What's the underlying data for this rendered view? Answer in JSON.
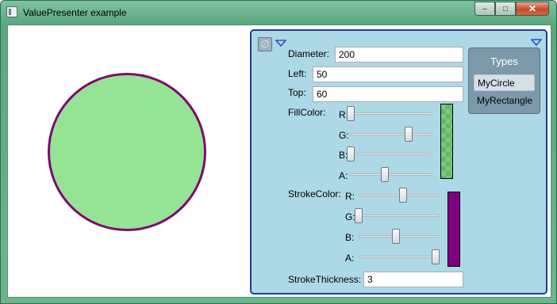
{
  "window": {
    "title": "ValuePresenter example",
    "controls": {
      "minimize": "–",
      "maximize": "□",
      "close": "✕"
    }
  },
  "panel": {
    "null_button": "∅",
    "diameter": {
      "label": "Diameter:",
      "value": "200"
    },
    "left": {
      "label": "Left:",
      "value": "50"
    },
    "top": {
      "label": "Top:",
      "value": "60"
    },
    "fill": {
      "label": "FillColor:",
      "r": "R:",
      "g": "G:",
      "b": "B:",
      "a": "A:",
      "values": {
        "r": 0.0,
        "g": 0.73,
        "b": 0.0,
        "a": 0.42
      },
      "color": "#95e394"
    },
    "stroke": {
      "label": "StrokeColor:",
      "r": "R:",
      "g": "G:",
      "b": "B:",
      "a": "A:",
      "values": {
        "r": 0.55,
        "g": 0.0,
        "b": 0.46,
        "a": 1.0
      },
      "color": "#800080"
    },
    "stroke_thickness": {
      "label": "StrokeThickness:",
      "value": "3"
    },
    "types": {
      "title": "Types",
      "items": [
        "MyCircle",
        "MyRectangle"
      ],
      "selected": "MyCircle"
    }
  },
  "shape": {
    "fill": "#95e394",
    "stroke": "#7d0a6d"
  }
}
